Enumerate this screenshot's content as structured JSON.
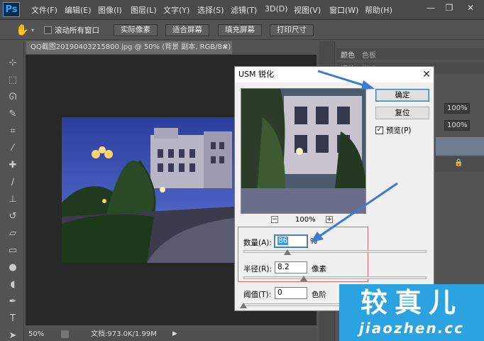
{
  "app": {
    "logo": "Ps"
  },
  "menu": [
    "文件(F)",
    "编辑(E)",
    "图像(I)",
    "图层(L)",
    "文字(Y)",
    "选择(S)",
    "滤镜(T)",
    "3D(D)",
    "视图(V)",
    "窗口(W)",
    "帮助(H)"
  ],
  "window_controls": {
    "minimize": "—",
    "restore": "❐",
    "close": "✕"
  },
  "options_bar": {
    "scroll_all_label": "滚动所有窗口",
    "buttons": [
      "实际像素",
      "适合屏幕",
      "填充屏幕",
      "打印尺寸"
    ]
  },
  "document": {
    "tab_title": "QQ截图20190403215800.jpg @ 50% (背景 副本, RGB/8#) *",
    "tab_close": "×",
    "zoom": "50%",
    "doc_info": "文档:973.0K/1.99M"
  },
  "panels": {
    "tabs_row1": [
      "颜色",
      "色板"
    ],
    "tabs_row2": [
      "调整",
      "样式"
    ],
    "opacity1": "100%",
    "opacity2": "100%",
    "lock_icon": "lock"
  },
  "dialog": {
    "title": "USM 锐化",
    "close": "✕",
    "ok_label": "确定",
    "reset_label": "复位",
    "preview_label": "预览(P)",
    "preview_checked": true,
    "zoom_minus": "−",
    "zoom_value": "100%",
    "zoom_plus": "+",
    "amount_label": "数量(A):",
    "amount_value": "86",
    "amount_unit": "%",
    "amount_level": 0.24,
    "radius_label": "半径(R):",
    "radius_value": "8.2",
    "radius_unit": "像素",
    "radius_level": 0.33,
    "threshold_label": "阈值(T):",
    "threshold_value": "0",
    "threshold_unit": "色阶",
    "threshold_level": 0.0
  },
  "watermark": {
    "title": "较真儿",
    "url": "jiaozhen.cc"
  },
  "colors": {
    "accent_arrow": "#3a7bd5",
    "highlight_box": "#e06060",
    "watermark_bg": "#2aa3e0"
  }
}
